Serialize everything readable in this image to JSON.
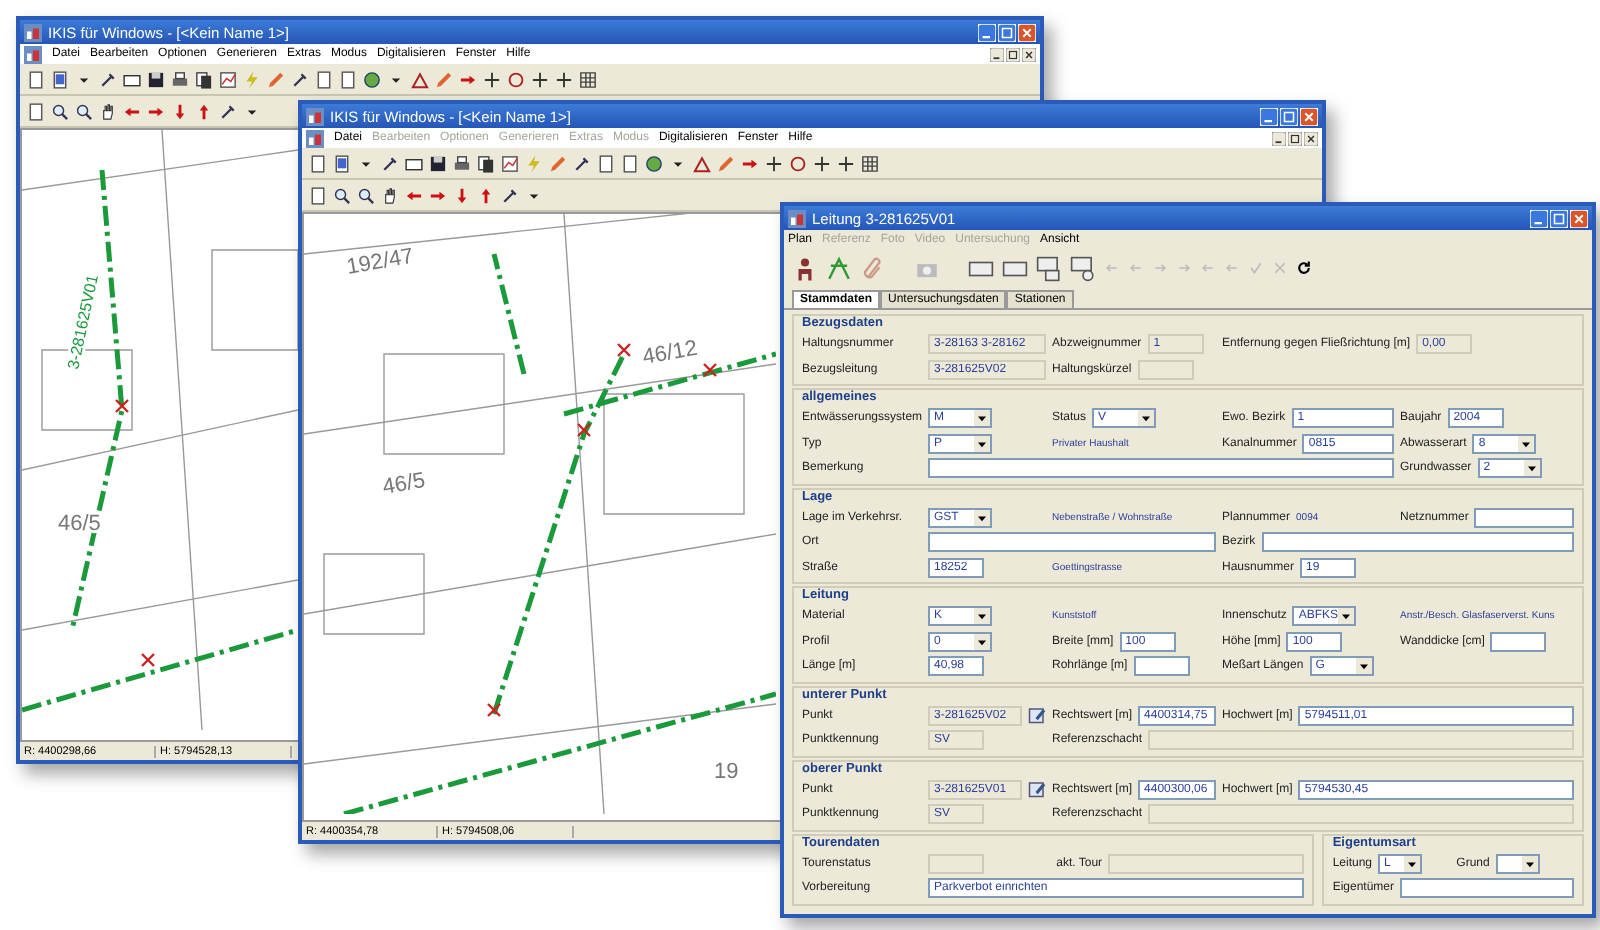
{
  "windows": [
    {
      "title": "IKIS für Windows - [<Kein Name 1>]",
      "menu": [
        {
          "label": "Datei",
          "disabled": false
        },
        {
          "label": "Bearbeiten",
          "disabled": false
        },
        {
          "label": "Optionen",
          "disabled": false
        },
        {
          "label": "Generieren",
          "disabled": false
        },
        {
          "label": "Extras",
          "disabled": false
        },
        {
          "label": "Modus",
          "disabled": false
        },
        {
          "label": "Digitalisieren",
          "disabled": false
        },
        {
          "label": "Fenster",
          "disabled": false
        },
        {
          "label": "Hilfe",
          "disabled": false
        }
      ],
      "map_labels": [
        "3-281625V01",
        "46/5"
      ],
      "status": [
        "R: 4400298,66",
        "H: 5794528,13"
      ]
    },
    {
      "title": "IKIS für Windows - [<Kein Name 1>]",
      "menu": [
        {
          "label": "Datei",
          "disabled": false
        },
        {
          "label": "Bearbeiten",
          "disabled": true
        },
        {
          "label": "Optionen",
          "disabled": true
        },
        {
          "label": "Generieren",
          "disabled": true
        },
        {
          "label": "Extras",
          "disabled": true
        },
        {
          "label": "Modus",
          "disabled": true
        },
        {
          "label": "Digitalisieren",
          "disabled": false
        },
        {
          "label": "Fenster",
          "disabled": false
        },
        {
          "label": "Hilfe",
          "disabled": false
        }
      ],
      "map_labels": [
        "192/47",
        "46/12",
        "46/5",
        "19"
      ],
      "status": [
        "R: 4400354,78",
        "H: 5794508,06"
      ]
    }
  ],
  "dialog": {
    "title": "Leitung 3-281625V01",
    "menu": [
      {
        "label": "Plan",
        "disabled": false
      },
      {
        "label": "Referenz",
        "disabled": true
      },
      {
        "label": "Foto",
        "disabled": true
      },
      {
        "label": "Video",
        "disabled": true
      },
      {
        "label": "Untersuchung",
        "disabled": true
      },
      {
        "label": "Ansicht",
        "disabled": false
      }
    ],
    "tabs": [
      {
        "label": "Stammdaten",
        "selected": true
      },
      {
        "label": "Untersuchungsdaten",
        "selected": false
      },
      {
        "label": "Stationen",
        "selected": false
      }
    ],
    "sections": [
      {
        "title": "Bezugsdaten",
        "rows": [
          [
            {
              "label": "Haltungsnummer",
              "control": {
                "kind": "field",
                "value": "3-28163 3-28162",
                "readonly": true
              }
            },
            {
              "label": "Abzweignummer",
              "control": {
                "kind": "short",
                "value": "1",
                "readonly": true
              }
            },
            {
              "label": "Entfernung gegen Fließrichtung [m]",
              "control": {
                "kind": "short",
                "value": "0,00",
                "readonly": true
              }
            },
            ""
          ],
          [
            {
              "label": "Bezugsleitung",
              "control": {
                "kind": "field",
                "value": "3-281625V02",
                "readonly": true
              }
            },
            {
              "label": "Haltungskürzel",
              "control": {
                "kind": "short",
                "readonly": true
              }
            },
            "",
            ""
          ]
        ]
      },
      {
        "title": "allgemeines",
        "rows": [
          [
            {
              "label": "Entwässerungssystem",
              "control": {
                "kind": "combo",
                "value": "M"
              }
            },
            {
              "label": "Status",
              "control": {
                "kind": "combo",
                "value": "V"
              }
            },
            {
              "label": "Ewo. Bezirk",
              "control": {
                "kind": "field",
                "value": "1",
                "readonly": false
              }
            },
            {
              "label": "Baujahr",
              "control": {
                "kind": "short",
                "value": "2004",
                "readonly": false
              }
            }
          ],
          [
            {
              "label": "Typ",
              "control": {
                "kind": "combo",
                "value": "P"
              }
            },
            {
              "note": "Privater Haushalt"
            },
            {
              "label": "Kanalnummer",
              "control": {
                "kind": "field",
                "value": "0815",
                "readonly": false
              }
            },
            {
              "label": "Abwasserart",
              "control": {
                "kind": "combo",
                "value": "8"
              }
            }
          ],
          [
            {
              "label": "Bemerkung",
              "control": {
                "kind": "field",
                "readonly": false
              }
            },
            "",
            "",
            {
              "label": "Grundwasser",
              "control": {
                "kind": "combo",
                "value": "2"
              }
            }
          ]
        ]
      },
      {
        "title": "Lage",
        "rows": [
          [
            {
              "label": "Lage im Verkehrsr.",
              "control": {
                "kind": "combo",
                "value": "GST"
              }
            },
            {
              "note": "Nebenstraße / Wohnstraße"
            },
            {
              "label": "Plannummer",
              "note": "0094"
            },
            {
              "label": "Netznummer",
              "control": {
                "kind": "field",
                "readonly": false
              }
            }
          ],
          [
            {
              "label": "Ort",
              "control": {
                "kind": "field",
                "readonly": false
              }
            },
            "",
            {
              "label": "Bezirk",
              "control": {
                "kind": "field",
                "readonly": false
              }
            },
            ""
          ],
          [
            {
              "label": "Straße",
              "control": {
                "kind": "short",
                "value": "18252",
                "readonly": false
              }
            },
            {
              "note": "Goettingstrasse"
            },
            {
              "label": "Hausnummer",
              "control": {
                "kind": "short",
                "value": "19",
                "readonly": false
              }
            },
            ""
          ]
        ]
      },
      {
        "title": "Leitung",
        "rows": [
          [
            {
              "label": "Material",
              "control": {
                "kind": "combo",
                "value": "K"
              }
            },
            {
              "note": "Kunststoff"
            },
            {
              "label": "Innenschutz",
              "control": {
                "kind": "combo",
                "value": "ABFKS"
              }
            },
            {
              "note": "Anstr./Besch. Glasfaserverst. Kuns"
            }
          ],
          [
            {
              "label": "Profil",
              "control": {
                "kind": "combo",
                "value": "0"
              }
            },
            {
              "label": "Breite [mm]",
              "control": {
                "kind": "short",
                "value": "100",
                "readonly": false
              }
            },
            {
              "label": "Höhe [mm]",
              "control": {
                "kind": "short",
                "value": "100",
                "readonly": false
              }
            },
            {
              "label": "Wanddicke [cm]",
              "control": {
                "kind": "short",
                "readonly": false
              }
            }
          ],
          [
            {
              "label": "Länge [m]",
              "control": {
                "kind": "short",
                "value": "40,98",
                "readonly": false
              }
            },
            {
              "label": "Rohrlänge [m]",
              "control": {
                "kind": "short",
                "readonly": false
              }
            },
            {
              "label": "Meßart Längen",
              "control": {
                "kind": "combo",
                "value": "G"
              }
            },
            ""
          ]
        ]
      },
      {
        "title": "unterer Punkt",
        "rows": [
          [
            {
              "label": "Punkt",
              "control": {
                "kind": "pick",
                "value": "3-281625V02",
                "readonly": true
              }
            },
            {
              "label": "Rechtswert [m]",
              "control": {
                "kind": "field",
                "value": "4400314,75",
                "readonly": false
              }
            },
            {
              "label": "Hochwert [m]",
              "control": {
                "kind": "field",
                "value": "5794511,01",
                "readonly": false
              }
            },
            ""
          ],
          [
            {
              "label": "Punktkennung",
              "control": {
                "kind": "short",
                "value": "SV",
                "readonly": true
              }
            },
            {
              "label": "Referenzschacht",
              "control": {
                "kind": "field",
                "readonly": true
              }
            },
            "",
            ""
          ]
        ]
      },
      {
        "title": "oberer Punkt",
        "rows": [
          [
            {
              "label": "Punkt",
              "control": {
                "kind": "pick",
                "value": "3-281625V01",
                "readonly": true
              }
            },
            {
              "label": "Rechtswert [m]",
              "control": {
                "kind": "field",
                "value": "4400300,06",
                "readonly": false
              }
            },
            {
              "label": "Hochwert [m]",
              "control": {
                "kind": "field",
                "value": "5794530,45",
                "readonly": false
              }
            },
            ""
          ],
          [
            {
              "label": "Punktkennung",
              "control": {
                "kind": "short",
                "value": "SV",
                "readonly": true
              }
            },
            {
              "label": "Referenzschacht",
              "control": {
                "kind": "field",
                "readonly": true
              }
            },
            "",
            ""
          ]
        ]
      }
    ],
    "bottom_sections": [
      {
        "title": "Tourendaten",
        "rows": [
          [
            {
              "label": "Tourenstatus",
              "control": {
                "kind": "short",
                "readonly": true
              }
            },
            {
              "label": "akt. Tour",
              "control": {
                "kind": "field",
                "readonly": true
              }
            }
          ],
          [
            {
              "label": "Vorbereitung",
              "control": {
                "kind": "field",
                "value": "Parkverbot einrichten",
                "readonly": false
              }
            },
            ""
          ]
        ]
      },
      {
        "title": "Eigentumsart",
        "rows": [
          [
            {
              "label": "Leitung",
              "control": {
                "kind": "combo",
                "value": "L"
              }
            },
            {
              "label": "Grund",
              "control": {
                "kind": "combo"
              }
            }
          ],
          [
            {
              "label": "Eigentümer",
              "control": {
                "kind": "field",
                "readonly": false
              }
            },
            ""
          ]
        ]
      }
    ]
  }
}
